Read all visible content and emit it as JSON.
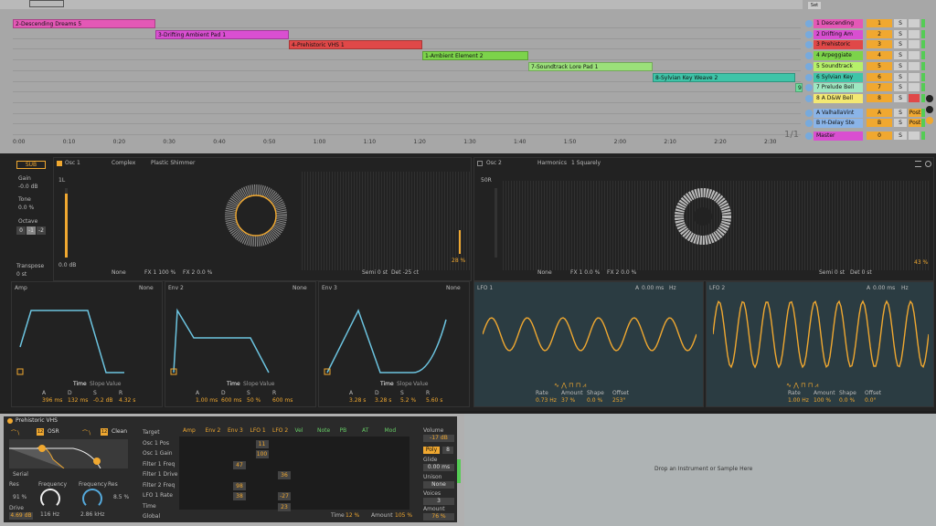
{
  "arrangement": {
    "clips": [
      {
        "label": "2-Descending Dreams 5",
        "color": "#e458b6"
      },
      {
        "label": "3-Drifting Ambient Pad 1",
        "color": "#d94fd1"
      },
      {
        "label": "4-Prehistoric VHS 1",
        "color": "#e04848"
      },
      {
        "label": "1-Ambient Element 2",
        "color": "#7cd34a"
      },
      {
        "label": "7-Soundtrack Lore Pad 1",
        "color": "#9be07a"
      },
      {
        "label": "8-Sylvian Key Weave 2",
        "color": "#3fc4a8"
      },
      {
        "label": "9-",
        "color": "#6edb9c"
      }
    ],
    "ticks": [
      "0:00",
      "0:10",
      "0:20",
      "0:30",
      "0:40",
      "0:50",
      "1:00",
      "1:10",
      "1:20",
      "1:30",
      "1:40",
      "1:50",
      "2:00",
      "2:10",
      "2:20",
      "2:30"
    ],
    "page_indicator": "1/1",
    "set_label": "Set"
  },
  "tracks": [
    {
      "name": "1 Descending",
      "num": "1",
      "color": "#e458b6"
    },
    {
      "name": "2 Drifting Am",
      "num": "2",
      "color": "#d94fd1"
    },
    {
      "name": "3 Prehistoric",
      "num": "3",
      "color": "#e04848"
    },
    {
      "name": "4 Arpeggiate",
      "num": "4",
      "color": "#7cd34a"
    },
    {
      "name": "5 Soundtrack",
      "num": "5",
      "color": "#b6f06a"
    },
    {
      "name": "6 Sylvian Key",
      "num": "6",
      "color": "#3fc4a8"
    },
    {
      "name": "7 Prelude Bell",
      "num": "7",
      "color": "#9fe7c1"
    },
    {
      "name": "8 A D&W Bell",
      "num": "8",
      "color": "#f3e873"
    },
    {
      "name": "A ValhallaVint",
      "num": "A",
      "color": "#8ab4e8"
    },
    {
      "name": "B H-Delay Ste",
      "num": "B",
      "color": "#8ab4e8"
    },
    {
      "name": "Master",
      "num": "0",
      "color": "#d94fd1"
    }
  ],
  "track_solo": "S",
  "post_label": "Post",
  "wavetable": {
    "sub_label": "SUB",
    "gain_label": "Gain",
    "gain_value": "-0.0 dB",
    "tone_label": "Tone",
    "tone_value": "0.0 %",
    "octave_label": "Octave",
    "octave_options": [
      "0",
      "-1",
      "-2"
    ],
    "transpose_label": "Transpose",
    "transpose_value": "0 st",
    "osc1": {
      "label": "Osc 1",
      "category": "Complex",
      "preset": "Plastic Shimmer",
      "pos_label": "1L",
      "gain": "0.0 dB",
      "fx_mode": "None",
      "fx1": "FX 1 100 %",
      "fx2": "FX 2 0.0 %",
      "semi": "Semi 0 st",
      "det": "Det -25 ct",
      "pos_value": "28 %"
    },
    "osc2": {
      "label": "Osc 2",
      "category": "Harmonics",
      "preset": "1 Squarely",
      "pos_label": "50R",
      "fx_mode": "None",
      "fx1": "FX 1 0.0 %",
      "fx2": "FX 2 0.0 %",
      "semi": "Semi 0 st",
      "det": "Det 0 st",
      "pos_value": "43 %"
    },
    "envs": [
      {
        "label": "Amp",
        "mode": "None",
        "a": "396 ms",
        "d": "132 ms",
        "s": "-0.2 dB",
        "r": "4.32 s"
      },
      {
        "label": "Env 2",
        "mode": "None",
        "a": "1.00 ms",
        "d": "600 ms",
        "s": "50 %",
        "r": "600 ms"
      },
      {
        "label": "Env 3",
        "mode": "None",
        "a": "3.28 s",
        "d": "3.28 s",
        "s": "5.2 %",
        "r": "5.60 s"
      }
    ],
    "env_tabs": [
      "Time",
      "Slope",
      "Value"
    ],
    "adsr": [
      "A",
      "D",
      "S",
      "R"
    ],
    "lfo1": {
      "label": "LFO 1",
      "a_label": "A",
      "a_value": "0.00 ms",
      "hz": "Hz",
      "rate": "0.73 Hz",
      "amount": "37 %",
      "shape": "0.0 %",
      "offset": "253°"
    },
    "lfo2": {
      "label": "LFO 2",
      "a_label": "A",
      "a_value": "0.00 ms",
      "hz": "Hz",
      "rate": "1.00 Hz",
      "amount": "100 %",
      "shape": "0.0 %",
      "offset": "0.0°"
    },
    "lfo_params": [
      "Rate",
      "Amount",
      "Shape",
      "Offset"
    ]
  },
  "device": {
    "title": "Prehistoric VHS",
    "filter_type": "OSR",
    "filter2_type": "Clean",
    "filter_num": "12",
    "filter2_num": "12",
    "serial": "Serial",
    "res_label": "Res",
    "res_value": "91 %",
    "freq_label": "Frequency",
    "freq_value": "116 Hz",
    "freq2_value": "2.86 kHz",
    "res2_value": "8.5 %",
    "drive_label": "Drive",
    "drive_value": "4.69 dB",
    "matrix_headers": [
      "Amp",
      "Env 2",
      "Env 3",
      "LFO 1",
      "LFO 2",
      "Vel",
      "Note",
      "PB",
      "AT",
      "Mod"
    ],
    "matrix_rows": [
      "Target",
      "Osc 1 Pos",
      "Osc 1 Gain",
      "Filter 1 Freq",
      "Filter 1 Drive",
      "Filter 2 Freq",
      "LFO 1 Rate",
      "Time",
      "Global"
    ],
    "matrix_values": [
      {
        "row": 1,
        "col": 3,
        "v": "11"
      },
      {
        "row": 2,
        "col": 3,
        "v": "100"
      },
      {
        "row": 3,
        "col": 2,
        "v": "47"
      },
      {
        "row": 4,
        "col": 4,
        "v": "36"
      },
      {
        "row": 5,
        "col": 2,
        "v": "98"
      },
      {
        "row": 6,
        "col": 2,
        "v": "38"
      },
      {
        "row": 6,
        "col": 4,
        "v": "-27"
      },
      {
        "row": 7,
        "col": 4,
        "v": "23"
      }
    ],
    "time_label": "Time",
    "time_value": "12 %",
    "amount_label": "Amount",
    "amount_value": "105 %",
    "volume_label": "Volume",
    "volume_value": "-17 dB",
    "poly_label": "Poly",
    "poly_num": "8",
    "glide_label": "Glide",
    "glide_value": "0.00 ms",
    "unison_label": "Unison",
    "unison_value": "None",
    "voices_label": "Voices",
    "voices_value": "3",
    "amount2_label": "Amount",
    "amount2_value": "76 %",
    "drop_text": "Drop an Instrument or Sample Here"
  }
}
